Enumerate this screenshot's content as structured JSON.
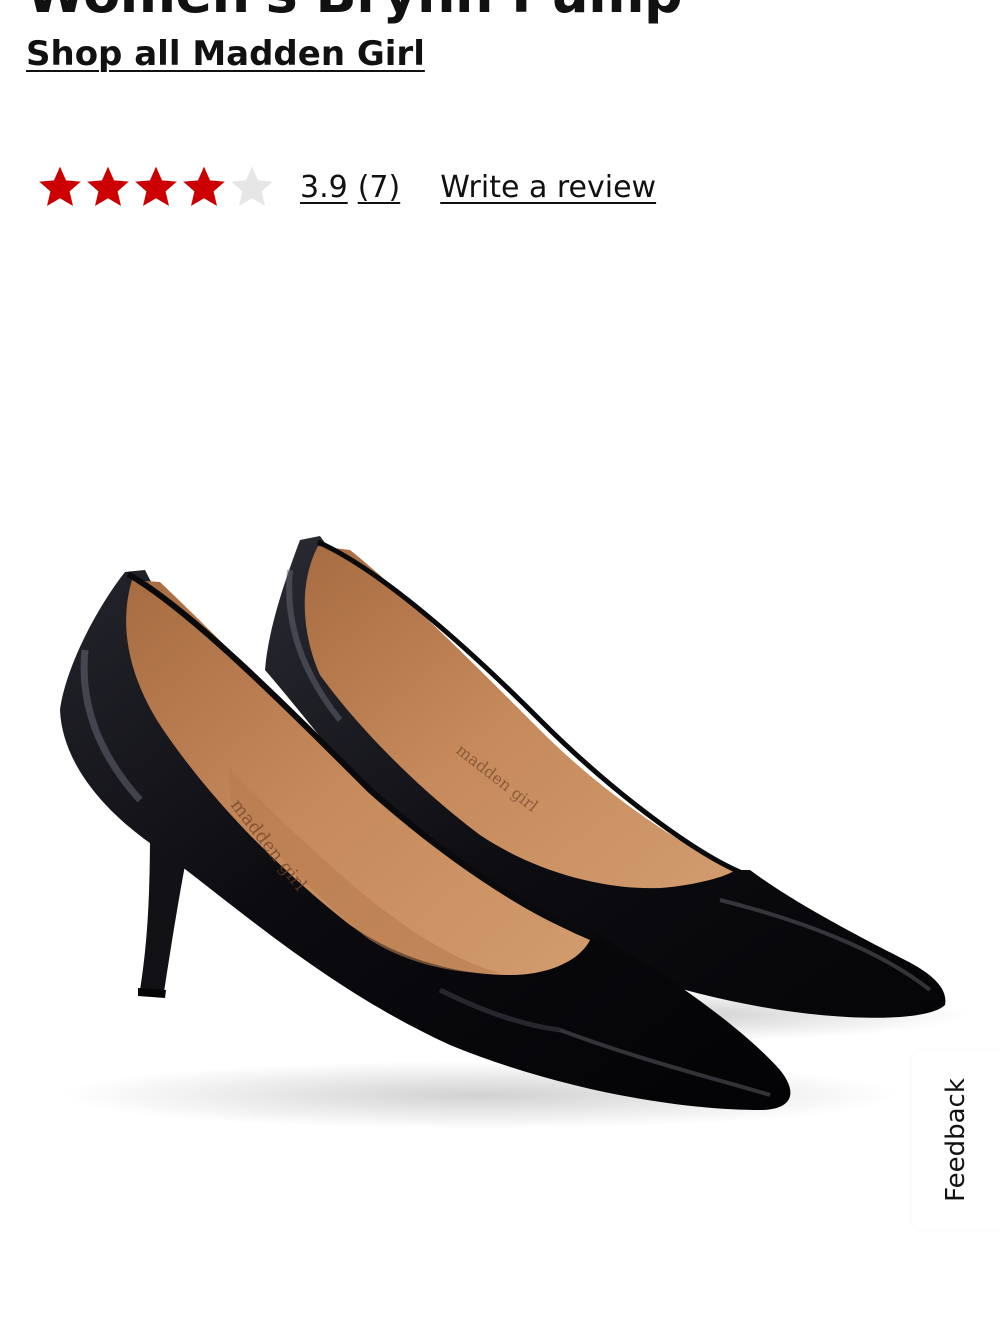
{
  "product": {
    "title": "Women's Brynn Pump",
    "brand_link": "Shop all Madden Girl"
  },
  "rating": {
    "value": "3.9",
    "count": "(7)",
    "stars_filled": 4,
    "stars_total": 5,
    "write_review": "Write a review"
  },
  "image": {
    "alt": "Black patent pointed-toe pumps with stiletto heels",
    "insole_text": "madden girl"
  },
  "feedback": {
    "label": "Feedback"
  },
  "colors": {
    "star_filled": "#cc0000",
    "star_empty": "#e6e6e6",
    "text": "#111111"
  },
  "icons": {
    "star": "star-icon"
  }
}
